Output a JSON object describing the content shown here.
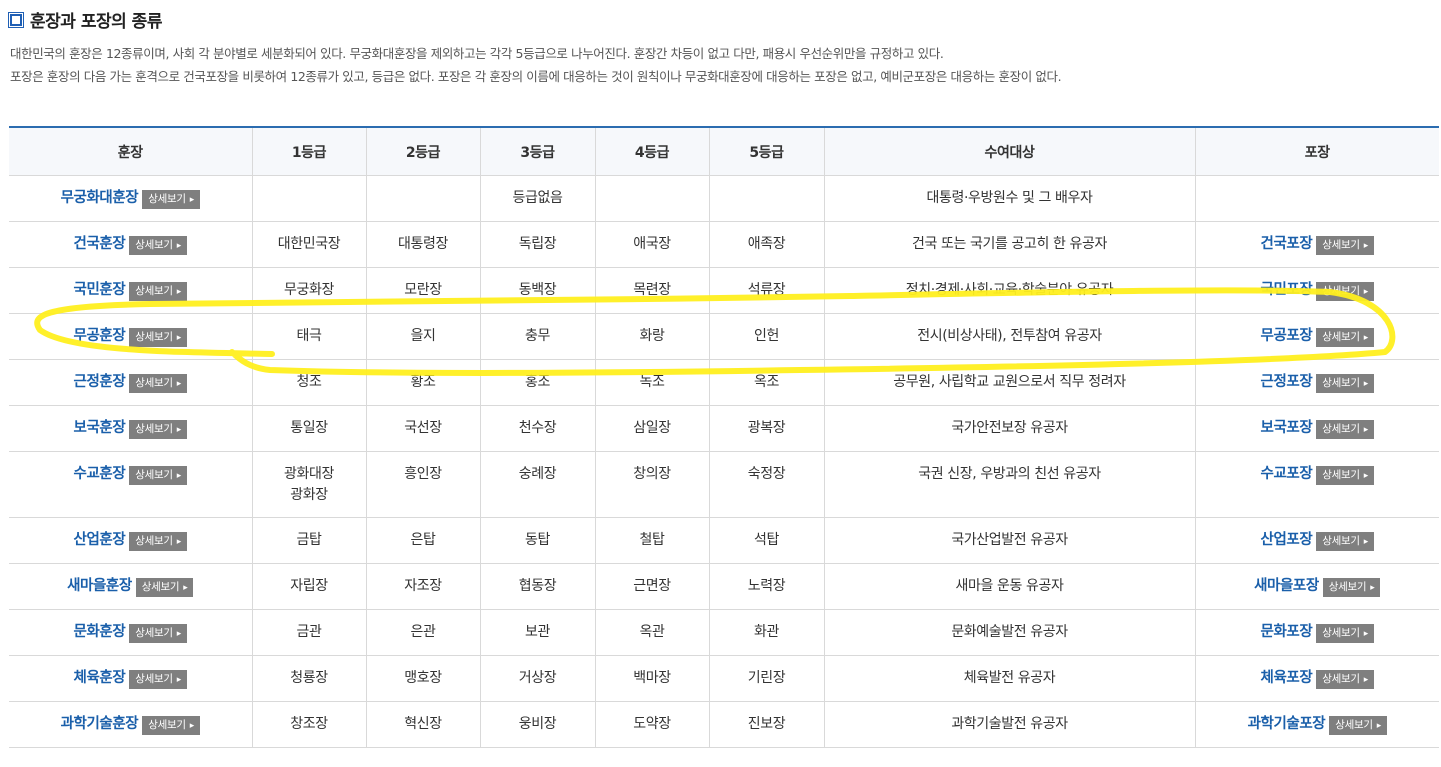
{
  "section": {
    "title": "훈장과 포장의 종류",
    "desc_line1": "대한민국의 훈장은 12종류이며, 사회 각 분야별로 세분화되어 있다. 무궁화대훈장을 제외하고는 각각 5등급으로 나누어진다. 훈장간 차등이 없고 다만, 패용시 우선순위만을 규정하고 있다.",
    "desc_line2": "포장은 훈장의 다음 가는 훈격으로 건국포장을 비롯하여 12종류가 있고, 등급은 없다. 포장은 각 훈장의 이름에 대응하는 것이 원칙이나 무궁화대훈장에 대응하는 포장은 없고, 예비군포장은 대응하는 훈장이 없다."
  },
  "detail_label": "상세보기",
  "headers": [
    "훈장",
    "1등급",
    "2등급",
    "3등급",
    "4등급",
    "5등급",
    "수여대상",
    "포장"
  ],
  "rows": [
    {
      "medal": "무궁화대훈장",
      "g1": "",
      "g2": "",
      "g3": "등급없음",
      "g4": "",
      "g5": "",
      "target": "대통령·우방원수 및 그 배우자",
      "badge": ""
    },
    {
      "medal": "건국훈장",
      "g1": "대한민국장",
      "g2": "대통령장",
      "g3": "독립장",
      "g4": "애국장",
      "g5": "애족장",
      "target": "건국 또는 국기를 공고히 한 유공자",
      "badge": "건국포장"
    },
    {
      "medal": "국민훈장",
      "g1": "무궁화장",
      "g2": "모란장",
      "g3": "동백장",
      "g4": "목련장",
      "g5": "석류장",
      "target": "정치·경제·사회·교육·학술분야 유공자",
      "badge": "국민포장"
    },
    {
      "medal": "무공훈장",
      "g1": "태극",
      "g2": "을지",
      "g3": "충무",
      "g4": "화랑",
      "g5": "인헌",
      "target": "전시(비상사태), 전투참여 유공자",
      "badge": "무공포장"
    },
    {
      "medal": "근정훈장",
      "g1": "청조",
      "g2": "황조",
      "g3": "홍조",
      "g4": "녹조",
      "g5": "옥조",
      "target": "공무원, 사립학교 교원으로서 직무 정려자",
      "badge": "근정포장"
    },
    {
      "medal": "보국훈장",
      "g1": "통일장",
      "g2": "국선장",
      "g3": "천수장",
      "g4": "삼일장",
      "g5": "광복장",
      "target": "국가안전보장 유공자",
      "badge": "보국포장"
    },
    {
      "medal": "수교훈장",
      "g1": "광화대장",
      "g1b": "광화장",
      "g2": "흥인장",
      "g3": "숭례장",
      "g4": "창의장",
      "g5": "숙정장",
      "target": "국권 신장, 우방과의 친선 유공자",
      "badge": "수교포장"
    },
    {
      "medal": "산업훈장",
      "g1": "금탑",
      "g2": "은탑",
      "g3": "동탑",
      "g4": "철탑",
      "g5": "석탑",
      "target": "국가산업발전 유공자",
      "badge": "산업포장"
    },
    {
      "medal": "새마을훈장",
      "g1": "자립장",
      "g2": "자조장",
      "g3": "협동장",
      "g4": "근면장",
      "g5": "노력장",
      "target": "새마을 운동 유공자",
      "badge": "새마을포장"
    },
    {
      "medal": "문화훈장",
      "g1": "금관",
      "g2": "은관",
      "g3": "보관",
      "g4": "옥관",
      "g5": "화관",
      "target": "문화예술발전 유공자",
      "badge": "문화포장"
    },
    {
      "medal": "체육훈장",
      "g1": "청룡장",
      "g2": "맹호장",
      "g3": "거상장",
      "g4": "백마장",
      "g5": "기린장",
      "target": "체육발전 유공자",
      "badge": "체육포장"
    },
    {
      "medal": "과학기술훈장",
      "g1": "창조장",
      "g2": "혁신장",
      "g3": "웅비장",
      "g4": "도약장",
      "g5": "진보장",
      "target": "과학기술발전 유공자",
      "badge": "과학기술포장"
    }
  ]
}
